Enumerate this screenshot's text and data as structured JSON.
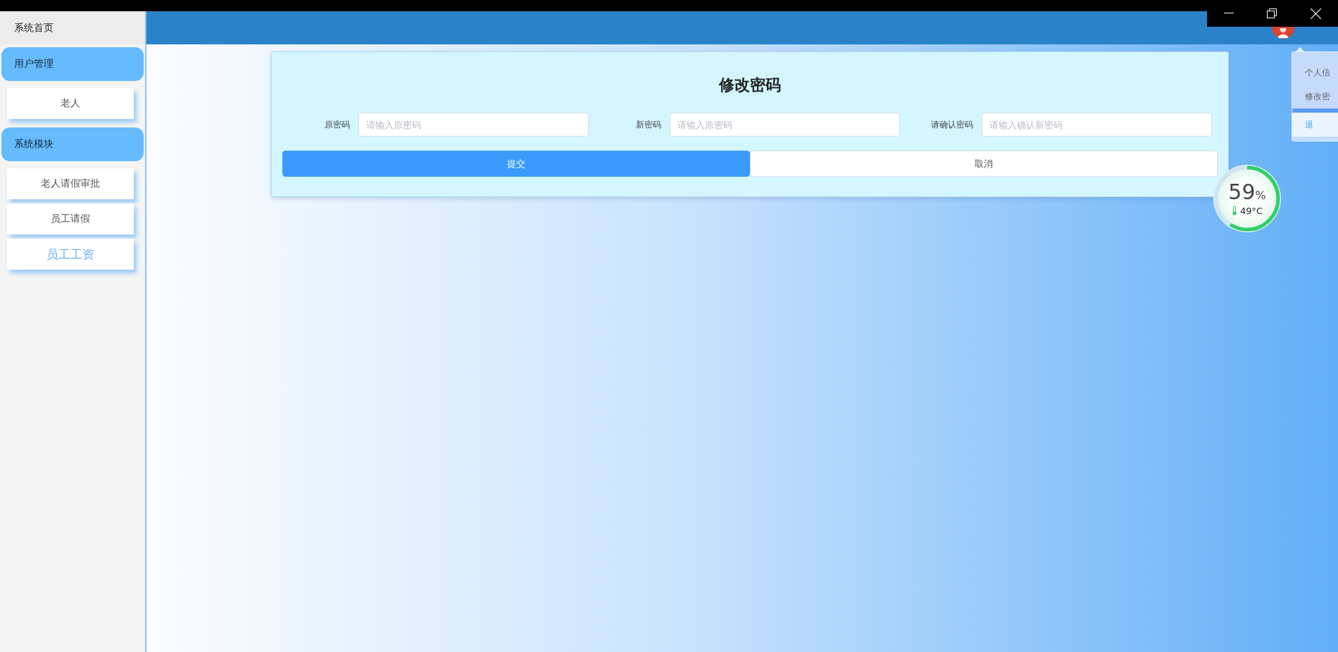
{
  "sidebar": {
    "home": "系统首页",
    "groups": [
      {
        "label": "用户管理",
        "items": [
          {
            "label": "老人",
            "selected": false
          }
        ]
      },
      {
        "label": "系统模块",
        "items": [
          {
            "label": "老人请假审批",
            "selected": false
          },
          {
            "label": "员工请假",
            "selected": false
          },
          {
            "label": "员工工资",
            "selected": true
          }
        ]
      }
    ]
  },
  "user_menu": {
    "items": [
      {
        "label": "个人信",
        "hovered": false
      },
      {
        "label": "修改密",
        "hovered": false
      },
      {
        "label": "退",
        "hovered": true
      }
    ]
  },
  "form": {
    "title": "修改密码",
    "fields": [
      {
        "label": "原密码",
        "placeholder": "请输入原密码"
      },
      {
        "label": "新密码",
        "placeholder": "请输入原密码"
      },
      {
        "label": "请确认密码",
        "placeholder": "请输入确认新密码"
      }
    ],
    "buttons": [
      {
        "label": "提交",
        "kind": "primary"
      },
      {
        "label": "取消",
        "kind": "default"
      }
    ]
  },
  "monitor": {
    "reading": "59",
    "unit": "%",
    "temperature": "49°C",
    "level": 0.59
  }
}
